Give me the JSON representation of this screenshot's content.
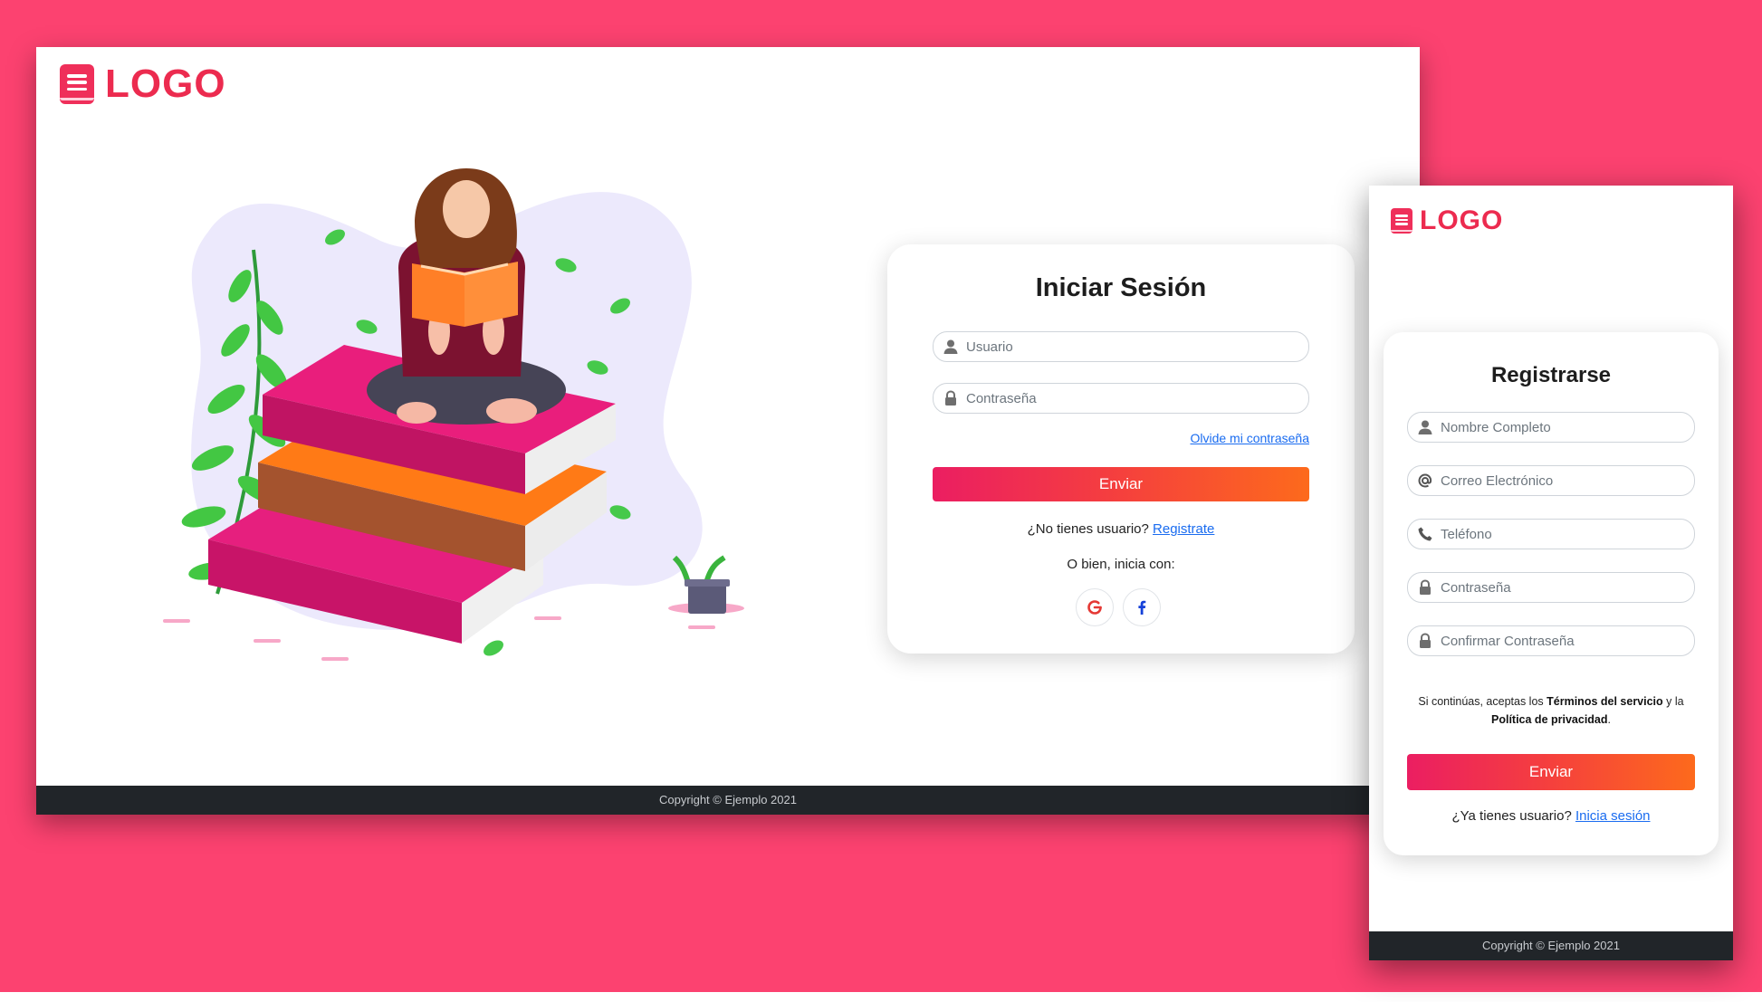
{
  "brand": {
    "logo_text": "LOGO",
    "accent": "#ec2b4f",
    "background": "#fc4270"
  },
  "desktop": {
    "login": {
      "title": "Iniciar Sesión",
      "username_placeholder": "Usuario",
      "password_placeholder": "Contraseña",
      "forgot_link": "Olvide mi contraseña",
      "submit_label": "Enviar",
      "no_account_text": "¿No tienes usuario?",
      "register_link": "Registrate",
      "alt_login_text": "O bien, inicia con:",
      "social": [
        {
          "name": "google",
          "icon": "google-icon",
          "color": "#e53935"
        },
        {
          "name": "facebook",
          "icon": "facebook-icon",
          "color": "#1541d8"
        }
      ]
    },
    "footer": "Copyright © Ejemplo 2021"
  },
  "mobile": {
    "register": {
      "title": "Registrarse",
      "fields": [
        {
          "placeholder": "Nombre Completo",
          "icon": "user-icon"
        },
        {
          "placeholder": "Correo Electrónico",
          "icon": "at-icon"
        },
        {
          "placeholder": "Teléfono",
          "icon": "phone-icon"
        },
        {
          "placeholder": "Contraseña",
          "icon": "lock-icon"
        },
        {
          "placeholder": "Confirmar Contraseña",
          "icon": "lock-icon"
        }
      ],
      "terms_prefix": "Si continúas, aceptas los",
      "terms_link": "Términos del servicio",
      "terms_middle": "y la",
      "privacy_link": "Política de privacidad",
      "terms_suffix": ".",
      "submit_label": "Enviar",
      "have_account_text": "¿Ya tienes usuario?",
      "login_link": "Inicia sesión"
    },
    "footer": "Copyright © Ejemplo 2021"
  }
}
